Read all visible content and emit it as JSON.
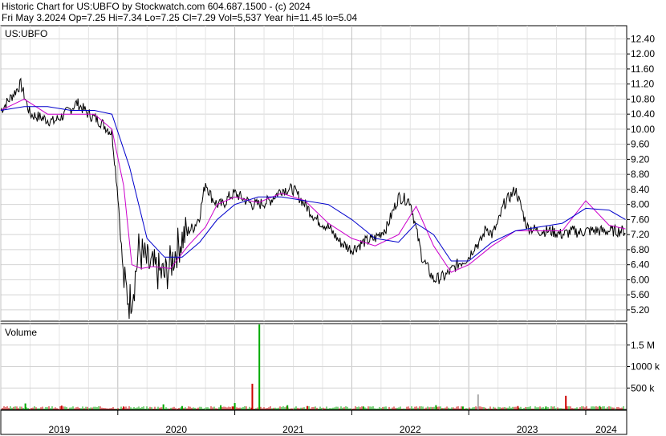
{
  "header": {
    "title": "Historic Chart for US:UBFO by Stockwatch.com 604.687.1500 - (c) 2024",
    "stats": "Fri May  3.2024  Op=7.25  Hi=7.34  Lo=7.25  Cl=7.29  Vol=5,537  Year hi=11.45  lo=5.04"
  },
  "chart_data": [
    {
      "type": "line",
      "name": "price-panel",
      "label": "US:UBFO",
      "ylim": [
        4.9,
        12.75
      ],
      "yticks": [
        "12.40",
        "12.00",
        "11.60",
        "11.20",
        "10.80",
        "10.40",
        "10.00",
        "9.60",
        "9.20",
        "8.80",
        "8.40",
        "8.00",
        "7.60",
        "7.20",
        "6.80",
        "6.40",
        "6.00",
        "5.60",
        "5.20"
      ],
      "grid": true,
      "colors": {
        "price": "#000000",
        "ma_short": "#cc00cc",
        "ma_long": "#0000cc"
      },
      "series": [
        {
          "key": "close",
          "x": [
            2019.0,
            2019.1,
            2019.17,
            2019.25,
            2019.35,
            2019.45,
            2019.55,
            2019.65,
            2019.75,
            2019.85,
            2019.95,
            2020.0,
            2020.05,
            2020.1,
            2020.14,
            2020.18,
            2020.22,
            2020.26,
            2020.3,
            2020.35,
            2020.4,
            2020.45,
            2020.5,
            2020.55,
            2020.6,
            2020.65,
            2020.7,
            2020.75,
            2020.8,
            2020.85,
            2020.9,
            2020.95,
            2021.0,
            2021.05,
            2021.1,
            2021.15,
            2021.2,
            2021.3,
            2021.4,
            2021.5,
            2021.6,
            2021.7,
            2021.8,
            2021.9,
            2022.0,
            2022.1,
            2022.2,
            2022.3,
            2022.4,
            2022.5,
            2022.6,
            2022.7,
            2022.8,
            2022.9,
            2023.0,
            2023.05,
            2023.1,
            2023.15,
            2023.2,
            2023.25,
            2023.3,
            2023.35,
            2023.4,
            2023.5,
            2023.6,
            2023.7,
            2023.8,
            2023.9,
            2023.95,
            2024.0,
            2024.05,
            2024.1,
            2024.15,
            2024.2,
            2024.25,
            2024.3,
            2024.34
          ],
          "y": [
            10.5,
            10.9,
            11.2,
            10.4,
            10.3,
            10.2,
            10.4,
            10.7,
            10.4,
            10.2,
            9.9,
            8.3,
            6.0,
            5.4,
            5.9,
            6.8,
            6.6,
            6.4,
            6.3,
            6.2,
            6.1,
            6.4,
            6.8,
            7.1,
            7.3,
            7.4,
            7.7,
            8.6,
            8.2,
            8.0,
            8.0,
            8.2,
            8.3,
            8.2,
            8.1,
            8.0,
            8.0,
            8.1,
            8.4,
            8.4,
            8.0,
            7.6,
            7.4,
            7.0,
            6.8,
            7.0,
            7.1,
            7.4,
            8.2,
            8.1,
            6.6,
            6.0,
            6.1,
            6.4,
            6.6,
            6.9,
            7.0,
            7.4,
            7.2,
            7.5,
            8.0,
            8.2,
            8.4,
            7.4,
            7.3,
            7.3,
            7.2,
            7.3,
            7.25,
            7.3,
            7.3,
            7.31,
            7.29,
            7.3,
            7.3,
            7.3,
            7.29
          ]
        },
        {
          "key": "ma_short",
          "x": [
            2019.0,
            2019.2,
            2019.4,
            2019.6,
            2019.8,
            2019.95,
            2020.05,
            2020.12,
            2020.2,
            2020.3,
            2020.45,
            2020.6,
            2020.75,
            2020.85,
            2021.0,
            2021.2,
            2021.4,
            2021.6,
            2021.8,
            2022.0,
            2022.2,
            2022.4,
            2022.55,
            2022.7,
            2022.85,
            2023.0,
            2023.2,
            2023.4,
            2023.6,
            2023.8,
            2024.0,
            2024.2,
            2024.34
          ],
          "y": [
            10.5,
            10.8,
            10.4,
            10.4,
            10.4,
            10.0,
            8.5,
            6.4,
            6.3,
            6.35,
            6.3,
            6.9,
            7.4,
            8.0,
            8.2,
            8.05,
            8.3,
            8.1,
            7.5,
            7.1,
            6.9,
            7.2,
            7.95,
            6.9,
            6.2,
            6.4,
            6.9,
            7.3,
            7.3,
            7.3,
            8.1,
            7.45,
            7.35
          ]
        },
        {
          "key": "ma_long",
          "x": [
            2019.0,
            2019.2,
            2019.4,
            2019.6,
            2019.8,
            2019.95,
            2020.1,
            2020.25,
            2020.4,
            2020.55,
            2020.7,
            2020.85,
            2021.0,
            2021.2,
            2021.4,
            2021.6,
            2021.8,
            2022.0,
            2022.2,
            2022.4,
            2022.55,
            2022.7,
            2022.85,
            2023.0,
            2023.2,
            2023.4,
            2023.6,
            2023.8,
            2024.0,
            2024.2,
            2024.34
          ],
          "y": [
            10.5,
            10.6,
            10.6,
            10.5,
            10.5,
            10.4,
            9.0,
            7.1,
            6.6,
            6.6,
            7.0,
            7.6,
            8.0,
            8.2,
            8.2,
            8.1,
            8.0,
            7.6,
            7.1,
            7.0,
            7.5,
            7.2,
            6.5,
            6.5,
            7.0,
            7.3,
            7.4,
            7.5,
            7.9,
            7.85,
            7.6
          ]
        }
      ]
    },
    {
      "type": "bar",
      "name": "volume-panel",
      "label": "Volume",
      "ylim": [
        0,
        2000000
      ],
      "yticks": [
        {
          "value": 1500000,
          "label": "1.5 M"
        },
        {
          "value": 1000000,
          "label": "1000 k"
        },
        {
          "value": 500000,
          "label": "500 k"
        }
      ],
      "baseline": 60000,
      "spikes": [
        {
          "x": 2019.21,
          "value": 140000,
          "color": "#00aa00"
        },
        {
          "x": 2019.52,
          "value": 90000,
          "color": "#cc0000"
        },
        {
          "x": 2020.05,
          "value": 70000,
          "color": "#cc0000"
        },
        {
          "x": 2020.39,
          "value": 120000,
          "color": "#00aa00"
        },
        {
          "x": 2020.55,
          "value": 80000,
          "color": "#00aa00"
        },
        {
          "x": 2021.0,
          "value": 150000,
          "color": "#00aa00"
        },
        {
          "x": 2020.88,
          "value": 100000,
          "color": "#00aa00"
        },
        {
          "x": 2020.98,
          "value": 70000,
          "color": "#cc0000"
        },
        {
          "x": 2021.15,
          "value": 600000,
          "color": "#cc0000"
        },
        {
          "x": 2021.21,
          "value": 1980000,
          "color": "#00aa00"
        },
        {
          "x": 2021.45,
          "value": 100000,
          "color": "#00aa00"
        },
        {
          "x": 2021.62,
          "value": 80000,
          "color": "#cc0000"
        },
        {
          "x": 2022.1,
          "value": 70000,
          "color": "#00aa00"
        },
        {
          "x": 2022.72,
          "value": 100000,
          "color": "#00aa00"
        },
        {
          "x": 2022.95,
          "value": 70000,
          "color": "#00aa00"
        },
        {
          "x": 2023.08,
          "value": 350000,
          "color": "#aaaaaa"
        },
        {
          "x": 2023.42,
          "value": 80000,
          "color": "#cc0000"
        },
        {
          "x": 2023.83,
          "value": 320000,
          "color": "#cc0000"
        },
        {
          "x": 2023.66,
          "value": 70000,
          "color": "#00aa00"
        },
        {
          "x": 2024.12,
          "value": 80000,
          "color": "#00aa00"
        }
      ]
    }
  ],
  "x_axis": {
    "range": [
      2019.0,
      2024.35
    ],
    "years": [
      "2019",
      "2020",
      "2021",
      "2022",
      "2023",
      "2024"
    ]
  }
}
